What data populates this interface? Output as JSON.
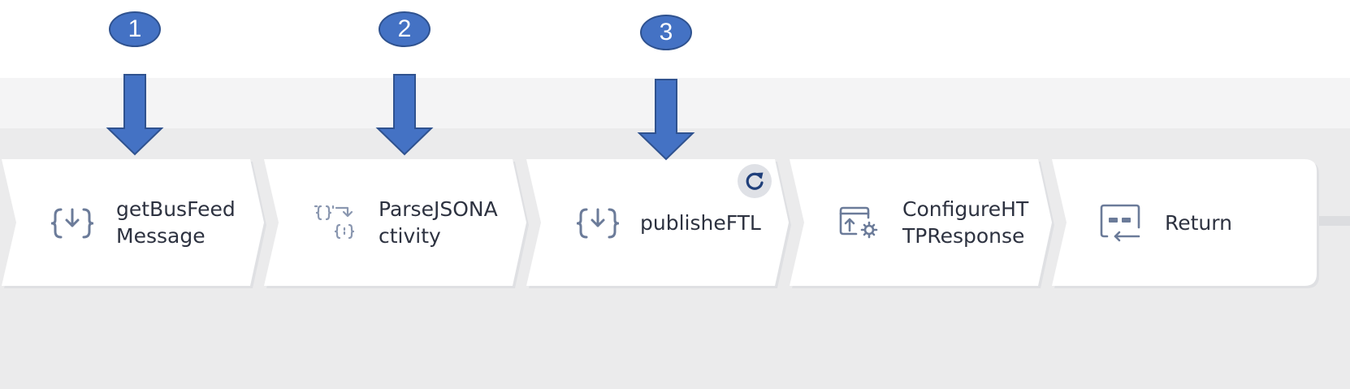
{
  "markers": [
    {
      "number": "1"
    },
    {
      "number": "2"
    },
    {
      "number": "3"
    }
  ],
  "activities": [
    {
      "label": "getBusFeed\nMessage",
      "icon": "receive-message-icon"
    },
    {
      "label": "ParseJSONA\nctivity",
      "icon": "parse-json-icon"
    },
    {
      "label": "publisheFTL",
      "icon": "publish-icon",
      "status_icon": "refresh-icon"
    },
    {
      "label": "ConfigureHT\nTPResponse",
      "icon": "configure-http-response-icon"
    },
    {
      "label": "Return",
      "icon": "return-icon"
    }
  ],
  "colors": {
    "marker_fill": "#4472c4",
    "marker_stroke": "#2f528f",
    "icon_color": "#6b7b99",
    "refresh_color": "#1f3f7a",
    "canvas_background": "#ebebec",
    "card_background": "#ffffff"
  }
}
